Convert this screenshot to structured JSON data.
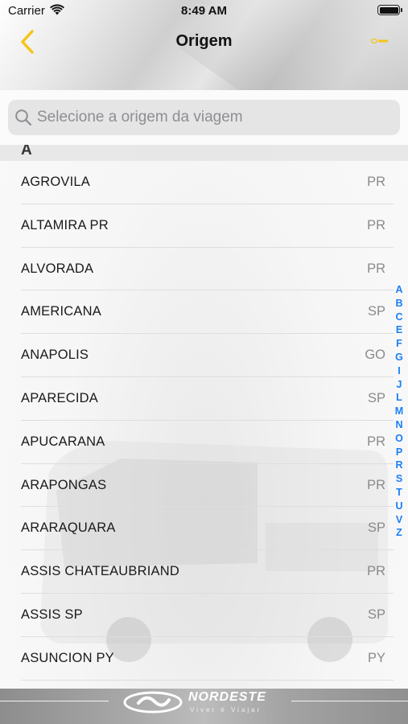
{
  "status_bar": {
    "carrier": "Carrier",
    "time": "8:49 AM"
  },
  "nav": {
    "title": "Origem",
    "back_icon": "chevron-left-icon",
    "logo_icon": "brand-logo-icon"
  },
  "search": {
    "placeholder": "Selecione a origem da viagem",
    "value": ""
  },
  "list": {
    "section_letter": "A",
    "rows": [
      {
        "city": "AGROVILA",
        "state": "PR"
      },
      {
        "city": "ALTAMIRA PR",
        "state": "PR"
      },
      {
        "city": "ALVORADA",
        "state": "PR"
      },
      {
        "city": "AMERICANA",
        "state": "SP"
      },
      {
        "city": "ANAPOLIS",
        "state": "GO"
      },
      {
        "city": "APARECIDA",
        "state": "SP"
      },
      {
        "city": "APUCARANA",
        "state": "PR"
      },
      {
        "city": "ARAPONGAS",
        "state": "PR"
      },
      {
        "city": "ARARAQUARA",
        "state": "SP"
      },
      {
        "city": "ASSIS CHATEAUBRIAND",
        "state": "PR"
      },
      {
        "city": "ASSIS SP",
        "state": "SP"
      },
      {
        "city": "ASUNCION PY",
        "state": "PY"
      }
    ]
  },
  "index_letters": [
    "A",
    "B",
    "C",
    "E",
    "F",
    "G",
    "I",
    "J",
    "L",
    "M",
    "N",
    "O",
    "P",
    "R",
    "S",
    "T",
    "U",
    "V",
    "Z"
  ],
  "footer": {
    "brand": "NORDESTE",
    "tagline": "Viver é Viajar"
  },
  "colors": {
    "accent_yellow": "#f5c518",
    "index_blue": "#1a7ff5",
    "search_bg": "#e5e5e6"
  }
}
